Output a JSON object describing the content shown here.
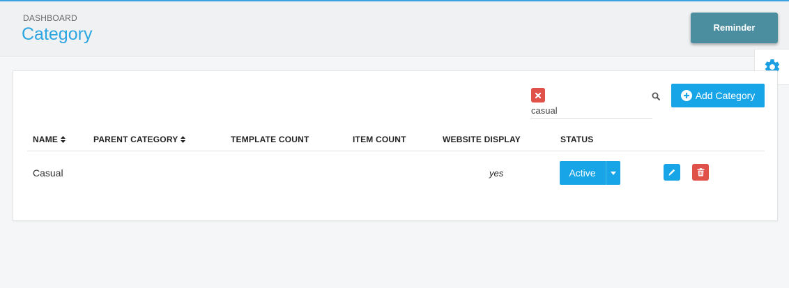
{
  "header": {
    "breadcrumb": "DASHBOARD",
    "title": "Category",
    "reminder_label": "Reminder"
  },
  "toolbar": {
    "search_value": "casual",
    "add_label": "Add Category"
  },
  "table": {
    "columns": {
      "name": "NAME",
      "parent_category": "PARENT CATEGORY",
      "template_count": "TEMPLATE COUNT",
      "item_count": "ITEM COUNT",
      "website_display": "WEBSITE DISPLAY",
      "status": "STATUS"
    },
    "rows": [
      {
        "name": "Casual",
        "parent_category": "",
        "template_count": "",
        "item_count": "",
        "website_display": "yes",
        "status": "Active"
      }
    ]
  },
  "icons": {
    "settings": "gear-icon",
    "clear": "close-icon",
    "search": "search-icon",
    "add": "plus-circle-icon",
    "sort": "sort-icon",
    "status_dropdown": "caret-down-icon",
    "edit": "pencil-icon",
    "delete": "trash-icon"
  },
  "colors": {
    "accent": "#17a5e8",
    "title": "#2ba6e1",
    "danger": "#e0514a",
    "reminder": "#4b8e9f"
  }
}
